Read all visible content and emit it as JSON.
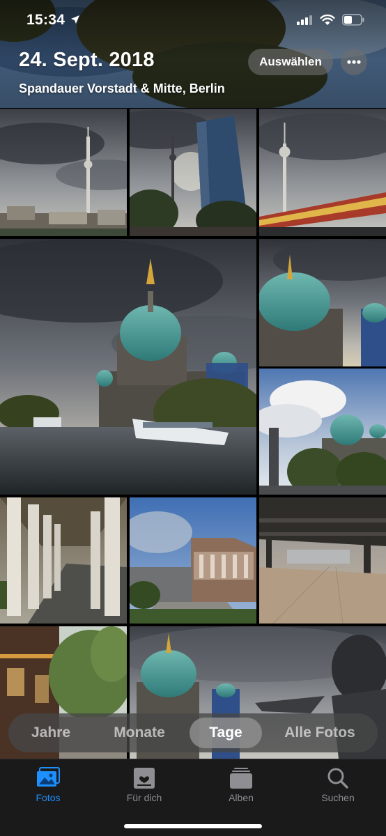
{
  "status_bar": {
    "time": "15:34"
  },
  "header": {
    "date_title": "24. Sept. 2018",
    "location_subtitle": "Spandauer Vorstadt & Mitte, Berlin",
    "select_button": "Auswählen"
  },
  "segmented_control": {
    "options": [
      "Jahre",
      "Monate",
      "Tage",
      "Alle Fotos"
    ],
    "selected": "Tage"
  },
  "tab_bar": {
    "tabs": [
      {
        "label": "Fotos",
        "icon": "photos-icon",
        "active": true
      },
      {
        "label": "Für dich",
        "icon": "for-you-icon",
        "active": false
      },
      {
        "label": "Alben",
        "icon": "albums-icon",
        "active": false
      },
      {
        "label": "Suchen",
        "icon": "search-icon",
        "active": false
      }
    ]
  },
  "colors": {
    "accent": "#1e8fff",
    "tab_inactive": "#8e8e93",
    "tab_bar_bg": "#1a1a1b"
  }
}
